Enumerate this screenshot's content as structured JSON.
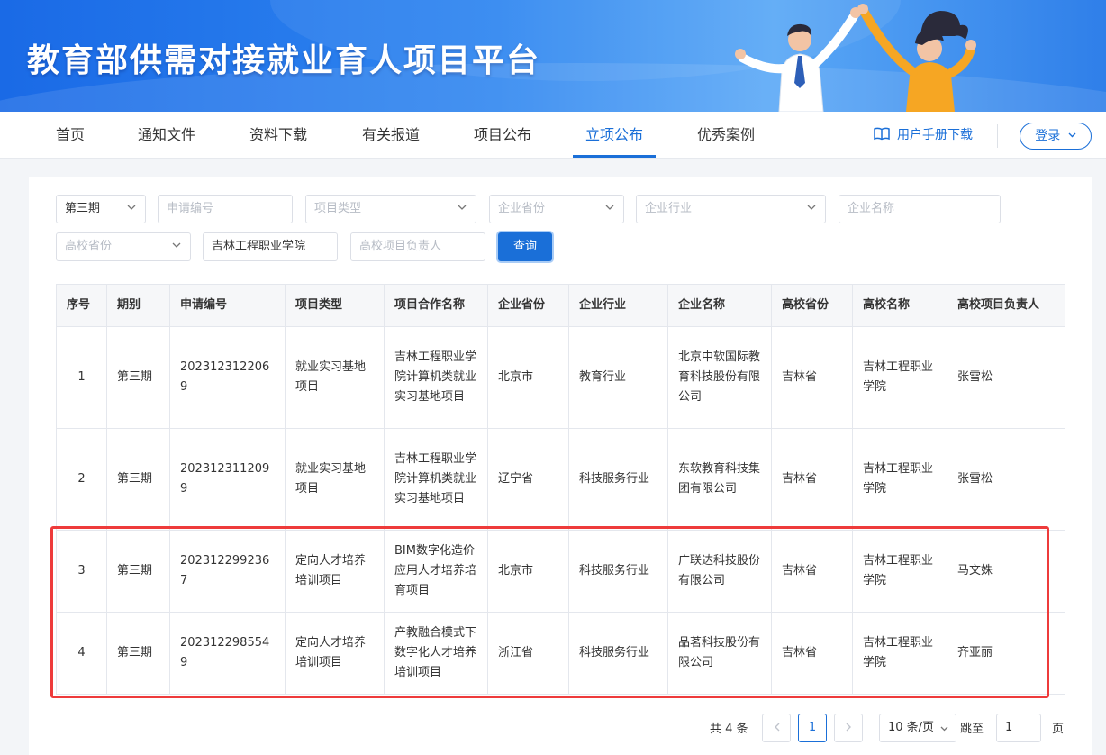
{
  "header": {
    "title": "教育部供需对接就业育人项目平台"
  },
  "nav": {
    "items": [
      {
        "label": "首页"
      },
      {
        "label": "通知文件"
      },
      {
        "label": "资料下载"
      },
      {
        "label": "有关报道"
      },
      {
        "label": "项目公布"
      },
      {
        "label": "立项公布"
      },
      {
        "label": "优秀案例"
      }
    ],
    "active": "立项公布",
    "manual_label": "用户手册下载",
    "login_label": "登录"
  },
  "filters": {
    "period": "第三期",
    "application_no_placeholder": "申请编号",
    "project_type_placeholder": "项目类型",
    "company_province_placeholder": "企业省份",
    "company_industry_placeholder": "企业行业",
    "company_name_placeholder": "企业名称",
    "school_province_placeholder": "高校省份",
    "school_name_value": "吉林工程职业学院",
    "school_leader_placeholder": "高校项目负责人",
    "search_label": "查询"
  },
  "table": {
    "columns": [
      "序号",
      "期别",
      "申请编号",
      "项目类型",
      "项目合作名称",
      "企业省份",
      "企业行业",
      "企业名称",
      "高校省份",
      "高校名称",
      "高校项目负责人"
    ],
    "rows": [
      [
        "1",
        "第三期",
        "2023123122069",
        "就业实习基地项目",
        "吉林工程职业学院计算机类就业实习基地项目",
        "北京市",
        "教育行业",
        "北京中软国际教育科技股份有限公司",
        "吉林省",
        "吉林工程职业学院",
        "张雪松"
      ],
      [
        "2",
        "第三期",
        "2023123112099",
        "就业实习基地项目",
        "吉林工程职业学院计算机类就业实习基地项目",
        "辽宁省",
        "科技服务行业",
        "东软教育科技集团有限公司",
        "吉林省",
        "吉林工程职业学院",
        "张雪松"
      ],
      [
        "3",
        "第三期",
        "2023122992367",
        "定向人才培养培训项目",
        "BIM数字化造价应用人才培养培育项目",
        "北京市",
        "科技服务行业",
        "广联达科技股份有限公司",
        "吉林省",
        "吉林工程职业学院",
        "马文姝"
      ],
      [
        "4",
        "第三期",
        "2023122985549",
        "定向人才培养培训项目",
        "产教融合模式下数字化人才培养培训项目",
        "浙江省",
        "科技服务行业",
        "品茗科技股份有限公司",
        "吉林省",
        "吉林工程职业学院",
        "齐亚丽"
      ]
    ]
  },
  "pagination": {
    "total": "共 4 条",
    "current_page": "1",
    "page_size": "10 条/页",
    "jump_label": "跳至",
    "jump_value": "1",
    "page_suffix": "页"
  },
  "colors": {
    "accent": "#1a6fd8",
    "highlight": "#ee3b3b"
  }
}
